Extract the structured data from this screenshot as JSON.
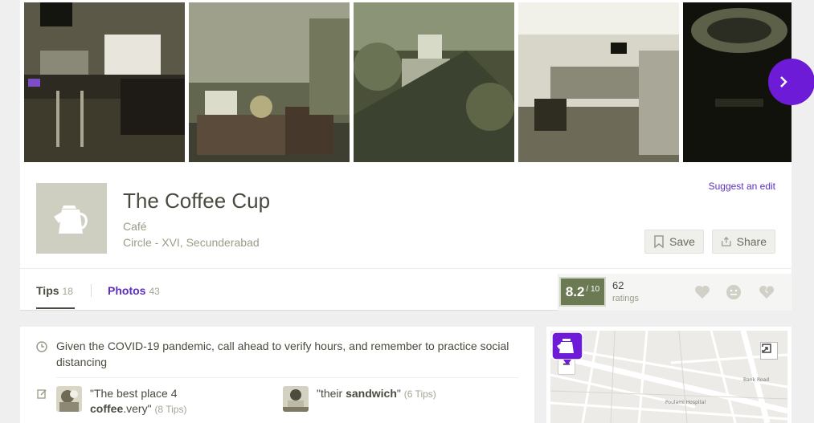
{
  "venue": {
    "name": "The Coffee Cup",
    "category": "Café",
    "location": "Circle - XVI, Secunderabad",
    "icon": "coffee-pot-icon"
  },
  "actions": {
    "suggest_edit": "Suggest an edit",
    "save": "Save",
    "share": "Share"
  },
  "tabs": [
    {
      "label": "Tips",
      "count": "18"
    },
    {
      "label": "Photos",
      "count": "43"
    }
  ],
  "rating": {
    "score": "8.2",
    "max": "/ 10",
    "count": "62",
    "count_label": "ratings",
    "score_color": "#6b7a53"
  },
  "notice": {
    "text": "Given the COVID-19 pandemic, call ahead to verify hours, and remember to practice social distancing"
  },
  "tips": [
    {
      "before": "\"The best place 4 ",
      "highlight": "coffee",
      "after": ".very\"",
      "count": "(8 Tips)"
    },
    {
      "before": "\"their ",
      "highlight": "sandwich",
      "after": "\"",
      "count": "(6 Tips)"
    }
  ],
  "map": {
    "zoom_in": "+",
    "zoom_out": "−",
    "hospital_label": "Poulami Hospital",
    "road_label": "Bank Road",
    "accent": "#6d1bd6"
  }
}
